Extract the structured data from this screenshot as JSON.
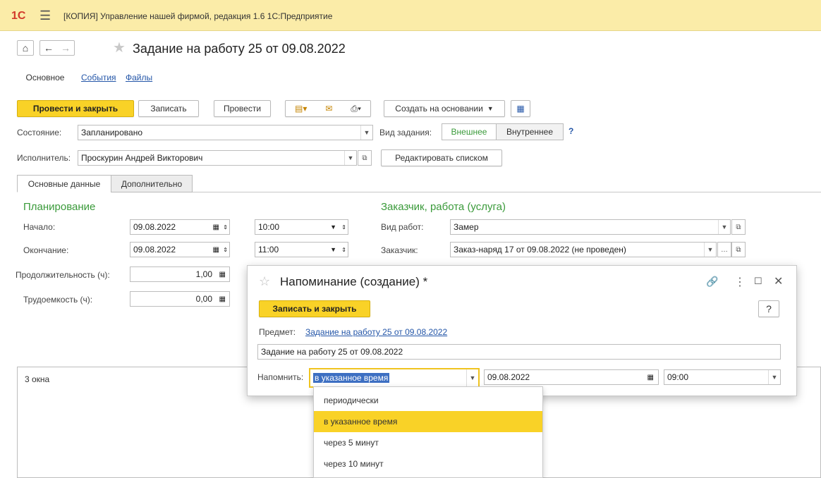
{
  "window": {
    "title": "[КОПИЯ] Управление нашей фирмой, редакция 1.6 1С:Предприятие",
    "logo": "1С"
  },
  "document": {
    "title": "Задание на работу 25 от 09.08.2022"
  },
  "nav_tabs": [
    "Основное",
    "События",
    "Файлы"
  ],
  "toolbar": {
    "post_close": "Провести и закрыть",
    "save": "Записать",
    "post": "Провести",
    "create_based_on": "Создать на основании"
  },
  "state": {
    "label": "Состояние:",
    "value": "Запланировано"
  },
  "task_kind": {
    "label": "Вид задания:",
    "option1": "Внешнее",
    "option2": "Внутреннее",
    "help": "?"
  },
  "executor": {
    "label": "Исполнитель:",
    "value": "Проскурин Андрей Викторович",
    "edit_list": "Редактировать списком"
  },
  "tabs": [
    "Основные данные",
    "Дополнительно"
  ],
  "planning": {
    "title": "Планирование",
    "start_label": "Начало:",
    "start_date": "09.08.2022",
    "start_time": "10:00",
    "end_label": "Окончание:",
    "end_date": "09.08.2022",
    "end_time": "11:00",
    "duration_label": "Продолжительность (ч):",
    "duration": "1,00",
    "labor_label": "Трудоемкость (ч):",
    "labor": "0,00"
  },
  "customer": {
    "title": "Заказчик, работа (услуга)",
    "work_kind_label": "Вид работ:",
    "work_kind": "Замер",
    "customer_label": "Заказчик:",
    "customer_value": "Заказ-наряд 17 от 09.08.2022 (не проведен)"
  },
  "comment_text": "3 окна",
  "dialog": {
    "title": "Напоминание (создание) *",
    "save_close": "Записать и закрыть",
    "help": "?",
    "subject_label": "Предмет:",
    "subject_link": "Задание на работу 25 от 09.08.2022",
    "text_value": "Задание на работу 25 от 09.08.2022",
    "remind_label": "Напомнить:",
    "remind_value": "в указанное время",
    "remind_date": "09.08.2022",
    "remind_time": "09:00"
  },
  "dropdown_options": [
    "периодически",
    "в указанное время",
    "через 5 минут",
    "через 10 минут"
  ],
  "colors": {
    "accent_yellow": "#f9d227",
    "title_bar": "#fbeca8",
    "green": "#3a9a3a",
    "link": "#2456a8"
  }
}
